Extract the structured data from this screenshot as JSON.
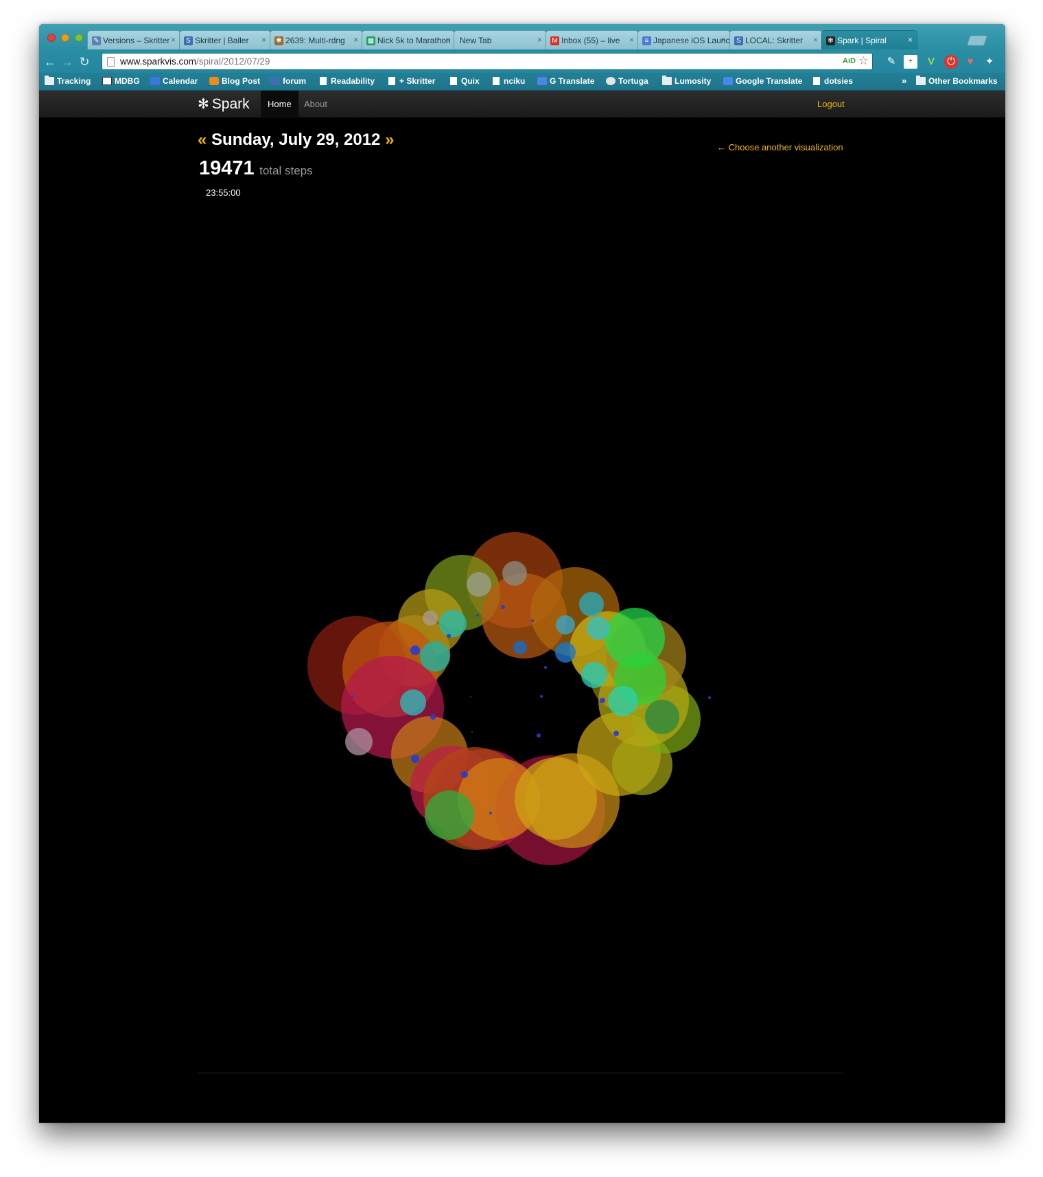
{
  "browser": {
    "tabs": [
      {
        "label": "Versions – Skritter",
        "icon": "versions-icon",
        "icon_color": "#5b7fb8"
      },
      {
        "label": "Skritter | Baller",
        "icon": "skritter-icon",
        "icon_color": "#3e6fb5"
      },
      {
        "label": "2639: Multi-rdng",
        "icon": "bug-icon",
        "icon_color": "#9b6a2f"
      },
      {
        "label": "Nick 5k to Marathon",
        "icon": "spreadsheet-icon",
        "icon_color": "#17a35a"
      },
      {
        "label": "New Tab",
        "icon": "",
        "icon_color": ""
      },
      {
        "label": "Inbox (55) – live",
        "icon": "gmail-icon",
        "icon_color": "#d93025"
      },
      {
        "label": "Japanese iOS Launch",
        "icon": "docs-icon",
        "icon_color": "#4a7bd6"
      },
      {
        "label": "LOCAL: Skritter",
        "icon": "skritter-icon",
        "icon_color": "#3e6fb5"
      },
      {
        "label": "Spark | Spiral",
        "icon": "spark-icon",
        "icon_color": "#222222"
      }
    ],
    "url_host": "www.sparkvis.com",
    "url_path": "/spiral/2012/07/29",
    "aid_badge": "AiD",
    "bookmarks": [
      {
        "label": "Tracking",
        "icon": "folder-icon"
      },
      {
        "label": "MDBG",
        "icon": "mdbg-icon"
      },
      {
        "label": "Calendar",
        "icon": "calendar-icon"
      },
      {
        "label": "Blog Post",
        "icon": "blogger-icon"
      },
      {
        "label": "forum",
        "icon": "skritter-icon"
      },
      {
        "label": "Readability",
        "icon": "doc-icon"
      },
      {
        "label": "+ Skritter",
        "icon": "doc-icon"
      },
      {
        "label": "Quix",
        "icon": "doc-icon"
      },
      {
        "label": "nciku",
        "icon": "doc-icon"
      },
      {
        "label": "G Translate",
        "icon": "translate-icon"
      },
      {
        "label": "Tortuga",
        "icon": "tortuga-icon"
      },
      {
        "label": "Lumosity",
        "icon": "folder-icon"
      },
      {
        "label": "Google Translate",
        "icon": "translate-icon"
      },
      {
        "label": "dotsies",
        "icon": "doc-icon"
      }
    ],
    "other_bookmarks": "Other Bookmarks",
    "overflow": "»"
  },
  "site": {
    "brand": "Spark",
    "nav": [
      "Home",
      "About"
    ],
    "logout": "Logout"
  },
  "day": {
    "prev_arrow": "«",
    "next_arrow": "»",
    "date": "Sunday, July 29, 2012",
    "steps": "19471",
    "steps_label": "total steps",
    "time": "23:55:00",
    "choose_link": "← Choose another visualization"
  },
  "colors": {
    "accent": "#f0b90a",
    "background": "#000000"
  }
}
